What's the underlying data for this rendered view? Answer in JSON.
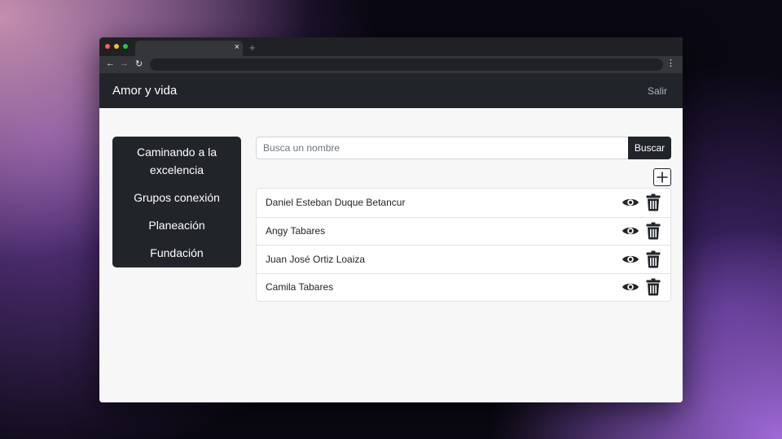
{
  "browser": {
    "tab_close": "×",
    "new_tab": "+",
    "back": "←",
    "forward": "→",
    "reload": "↻",
    "menu": "⋮",
    "dot_colors": [
      "#ff5f57",
      "#febc2e",
      "#28c840"
    ]
  },
  "navbar": {
    "brand": "Amor y vida",
    "logout": "Salir"
  },
  "sidebar": {
    "items": [
      {
        "label": "Caminando a la excelencia"
      },
      {
        "label": "Grupos conexión"
      },
      {
        "label": "Planeación"
      },
      {
        "label": "Fundación"
      }
    ]
  },
  "search": {
    "placeholder": "Busca un nombre",
    "value": "",
    "button": "Buscar"
  },
  "list": {
    "add_icon": "plus-icon",
    "view_icon": "eye-icon",
    "delete_icon": "trash-icon",
    "items": [
      {
        "name": "Daniel Esteban Duque Betancur"
      },
      {
        "name": "Angy Tabares"
      },
      {
        "name": "Juan José Ortiz Loaiza"
      },
      {
        "name": "Camila Tabares"
      }
    ]
  },
  "colors": {
    "dark": "#212529",
    "background": "#f7f7f7"
  }
}
